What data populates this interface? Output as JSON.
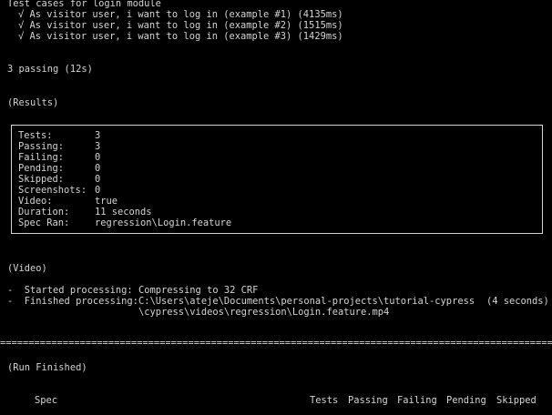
{
  "suite": {
    "title": "Test cases for login module",
    "tests": [
      {
        "mark": "√",
        "text": "As visitor user, i want to log in (example #1) (4135ms)"
      },
      {
        "mark": "√",
        "text": "As visitor user, i want to log in (example #2) (1515ms)"
      },
      {
        "mark": "√",
        "text": "As visitor user, i want to log in (example #3) (1429ms)"
      }
    ],
    "passing_summary": "3 passing (12s)"
  },
  "results": {
    "heading": "(Results)",
    "rows": [
      {
        "key": "Tests:",
        "value": "3"
      },
      {
        "key": "Passing:",
        "value": "3"
      },
      {
        "key": "Failing:",
        "value": "0"
      },
      {
        "key": "Pending:",
        "value": "0"
      },
      {
        "key": "Skipped:",
        "value": "0"
      },
      {
        "key": "Screenshots:",
        "value": "0"
      },
      {
        "key": "Video:",
        "value": "true"
      },
      {
        "key": "Duration:",
        "value": "11 seconds"
      },
      {
        "key": "Spec Ran:",
        "value": "regression\\Login.feature"
      }
    ]
  },
  "video": {
    "heading": "(Video)",
    "started_label": "-  Started processing:",
    "started_value": "Compressing to 32 CRF",
    "finished_label": "-  Finished processing:",
    "finished_path_1": "C:\\Users\\ateje\\Documents\\personal-projects\\tutorial-cypress",
    "finished_path_2": "\\cypress\\videos\\regression\\Login.feature.mp4",
    "finished_time": "(4 seconds)"
  },
  "run_finished": {
    "heading": "(Run Finished)",
    "columns": [
      "Spec",
      "Tests",
      "Passing",
      "Failing",
      "Pending",
      "Skipped"
    ]
  },
  "colors": {
    "background": "#000000",
    "foreground": "#d4d4d4"
  }
}
